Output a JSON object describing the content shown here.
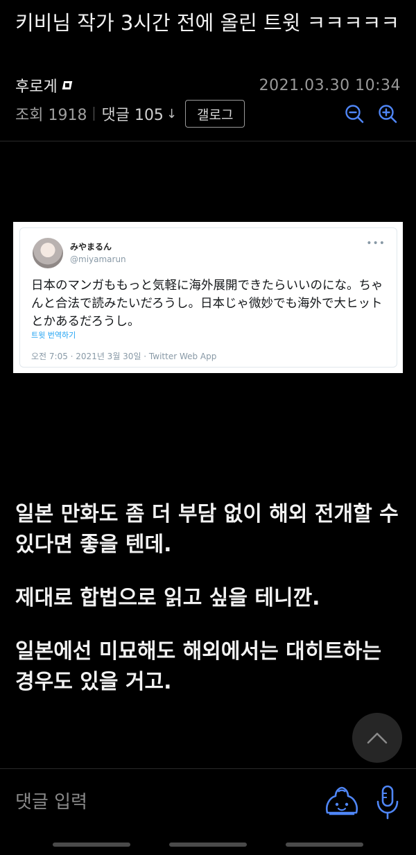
{
  "post": {
    "title": "키비님 작가 3시간 전에 올린 트윗 ㅋㅋㅋㅋㅋ",
    "author": "후로게",
    "date": "2021.03.30 10:34",
    "views": "조회 1918",
    "comments": "댓글 105",
    "gallery_button": "갤로그"
  },
  "tweet": {
    "name": "みやまるん",
    "handle": "@miyamarun",
    "text": "日本のマンガももっと気軽に海外展開できたらいいのにな。ちゃんと合法で読みたいだろうし。日本じゃ微妙でも海外で大ヒットとかあるだろうし。",
    "translate": "트윗 번역하기",
    "timestamp": "오전 7:05 · 2021년 3월 30일 · Twitter Web App"
  },
  "body": {
    "paragraphs": [
      "일본 만화도 좀 더 부담 없이 해외 전개할 수 있다면 좋을 텐데.",
      "제대로 합법으로 읽고 싶을 테니깐.",
      "일본에선 미묘해도 해외에서는 대히트하는 경우도 있을 거고."
    ]
  },
  "footer": {
    "comment_placeholder": "댓글 입력"
  },
  "icons": {
    "zoom_out": "zoom-out-icon",
    "zoom_in": "zoom-in-icon",
    "scroll_top": "chevron-up-icon",
    "emoji": "emoji-icon",
    "mic": "microphone-icon",
    "sort": "sort-down-arrow-icon"
  },
  "colors": {
    "background": "#000000",
    "accent": "#4f86f7",
    "twitter_blue": "#1da1f2"
  }
}
